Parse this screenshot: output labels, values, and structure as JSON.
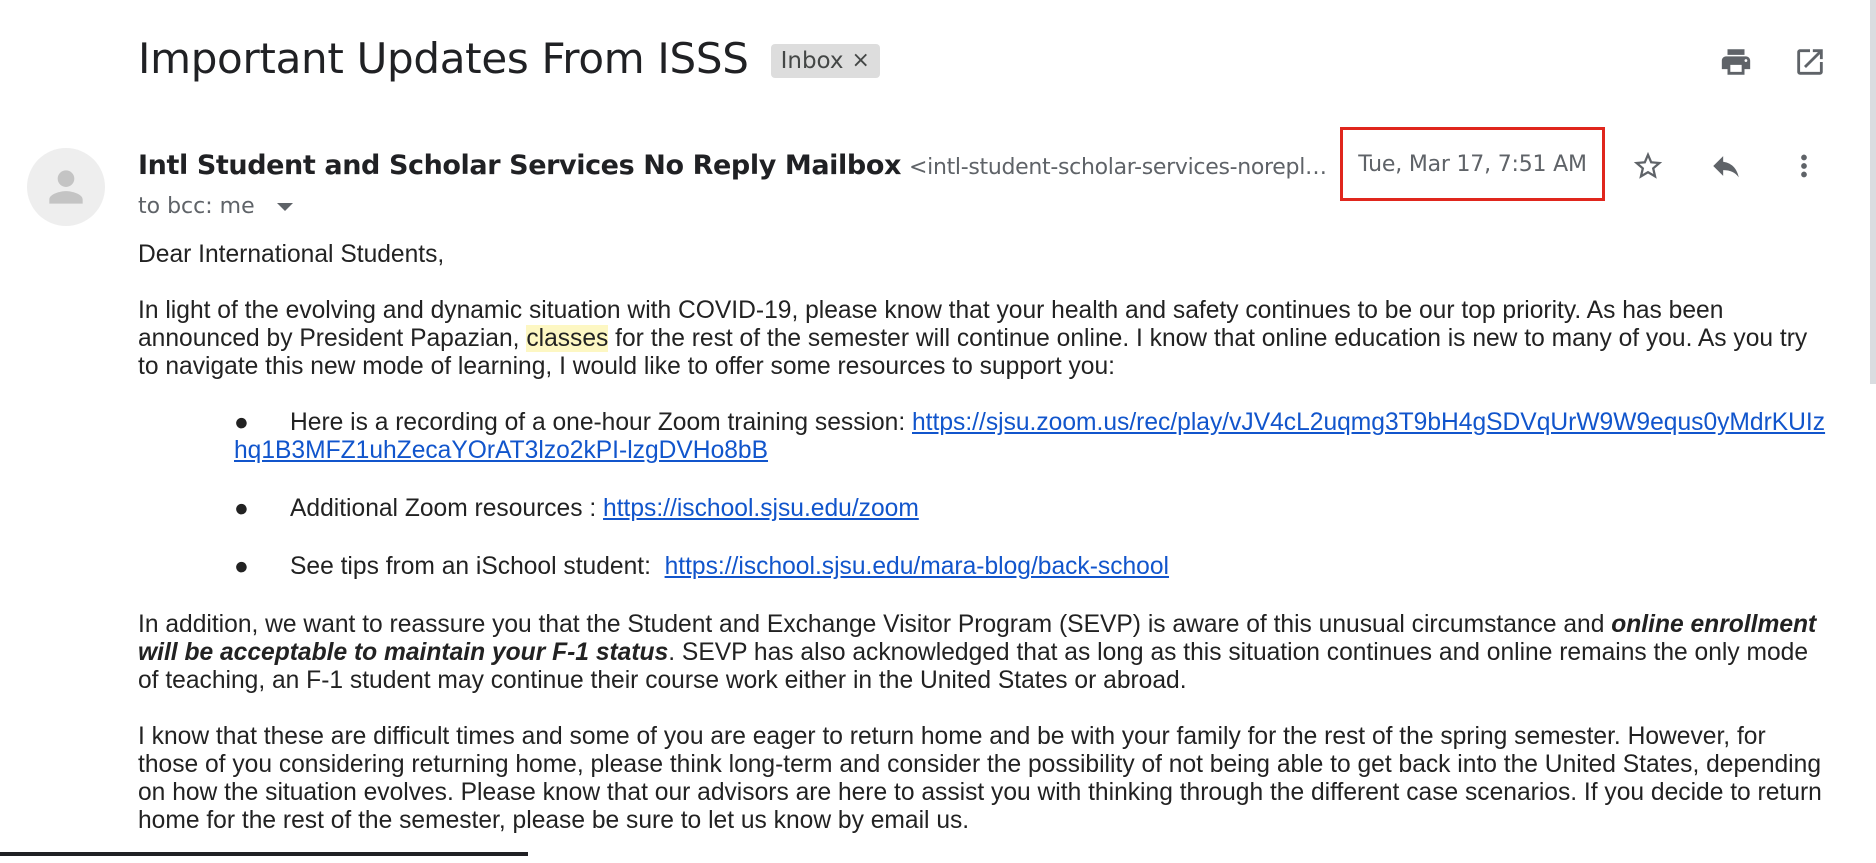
{
  "email": {
    "subject": "Important Updates From ISSS",
    "label": "Inbox",
    "label_close": "×",
    "sender_name": "Intl Student and Scholar Services No Reply Mailbox",
    "sender_email": "<intl-student-scholar-services-noreply@sjsu.e…",
    "date": "Tue, Mar 17, 7:51 AM",
    "recipients": "to bcc: me"
  },
  "icons": {
    "print": "print-icon",
    "open_new_window": "open-in-new-window-icon",
    "star": "star-icon",
    "reply": "reply-icon",
    "more": "more-vert-icon",
    "avatar": "person-icon"
  },
  "colors": {
    "highlight_border": "#e0261d",
    "link": "#1155cc"
  },
  "body": {
    "greeting": "Dear International Students,",
    "p1_a": "In light of the evolving and dynamic situation with COVID-19, please know that your health and safety continues to be our top priority. As has been announced by President Papazian, ",
    "p1_hl": "classes",
    "p1_b": " for the rest of the semester will continue online. I know that online education is new to many of you. As you try to navigate this new mode of learning, I would like to offer some resources to support you:",
    "bullets": [
      {
        "dot": "●",
        "text": "Here is a recording of a one-hour Zoom training session: ",
        "link": "https://sjsu.zoom.us/rec/play/vJV4cL2uqmg3T9bH4gSDVqUrW9W9equs0yMdrKUIzhq1B3MFZ1uhZecaYOrAT3lzo2kPI-lzgDVHo8bB"
      },
      {
        "dot": "●",
        "text": "Additional Zoom resources : ",
        "link": "https://ischool.sjsu.edu/zoom"
      },
      {
        "dot": "●",
        "text": "See tips from an iSchool student:  ",
        "link": "https://ischool.sjsu.edu/mara-blog/back-school"
      }
    ],
    "p2_a": "In addition, we want to reassure you that the Student and Exchange Visitor Program (SEVP) is aware of this unusual circumstance and ",
    "p2_bold": "online enrollment will be acceptable to maintain your F-1 status",
    "p2_b": ". SEVP has also acknowledged that as long as this situation continues and online remains the only mode of teaching, an F-1 student may continue their course work either in the United States or abroad.",
    "p3": "I know that these are difficult times and some of you are eager to return home and be with your family for the rest of the spring semester. However, for those of you considering returning home, please think long-term and consider the possibility of not being able to get back into the United States, depending on how the situation evolves. Please know that our advisors are here to assist you with thinking through the different case scenarios. If you decide to return home for the rest of the semester, please be sure to let us know by email us."
  }
}
